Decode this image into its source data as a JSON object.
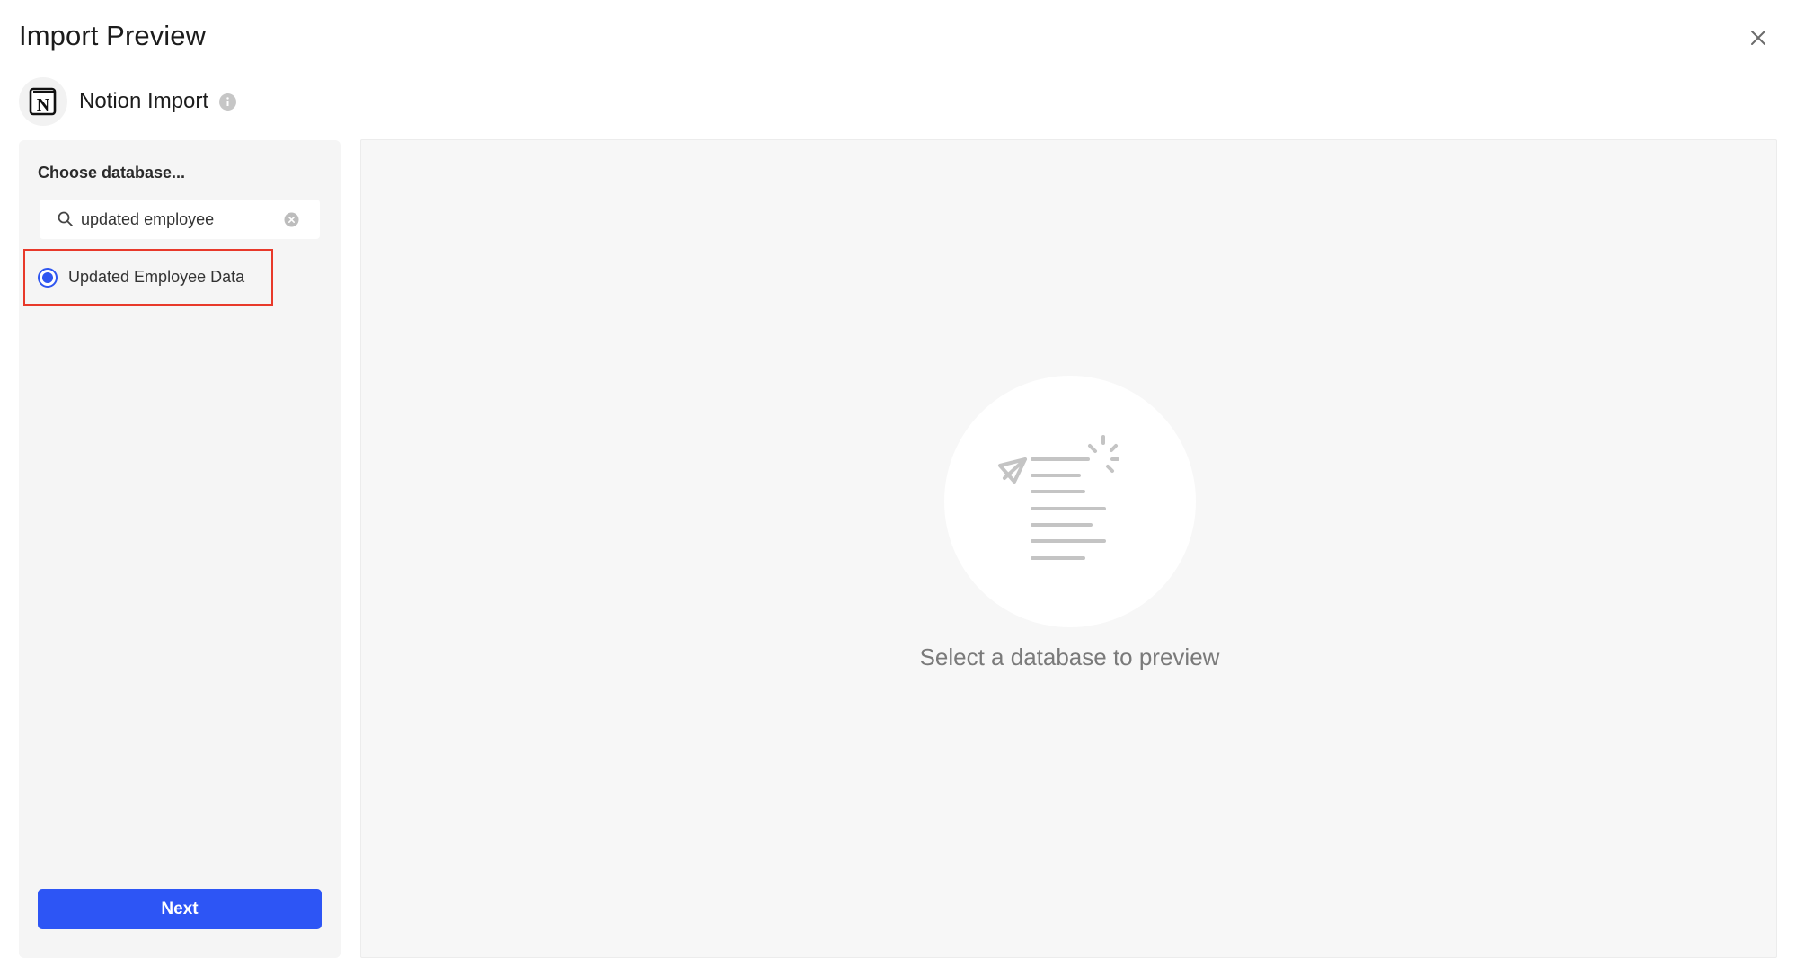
{
  "dialog": {
    "title": "Import Preview"
  },
  "source": {
    "label": "Notion Import",
    "logo_letter": "N"
  },
  "sidebar": {
    "choose_label": "Choose database...",
    "search": {
      "value": "updated employee",
      "placeholder": ""
    },
    "options": [
      {
        "label": "Updated Employee Data",
        "selected": true
      }
    ],
    "next_label": "Next"
  },
  "preview": {
    "empty_text": "Select a database to preview"
  },
  "colors": {
    "accent": "#2d55f5",
    "highlight_border": "#e8392a",
    "sidebar_bg": "#f5f5f5",
    "preview_bg": "#f7f7f7"
  },
  "icons": {
    "close": "close-icon",
    "logo": "notion-logo-icon",
    "info": "info-icon",
    "search": "search-icon",
    "clear": "clear-icon",
    "illustration": "document-send-icon"
  }
}
